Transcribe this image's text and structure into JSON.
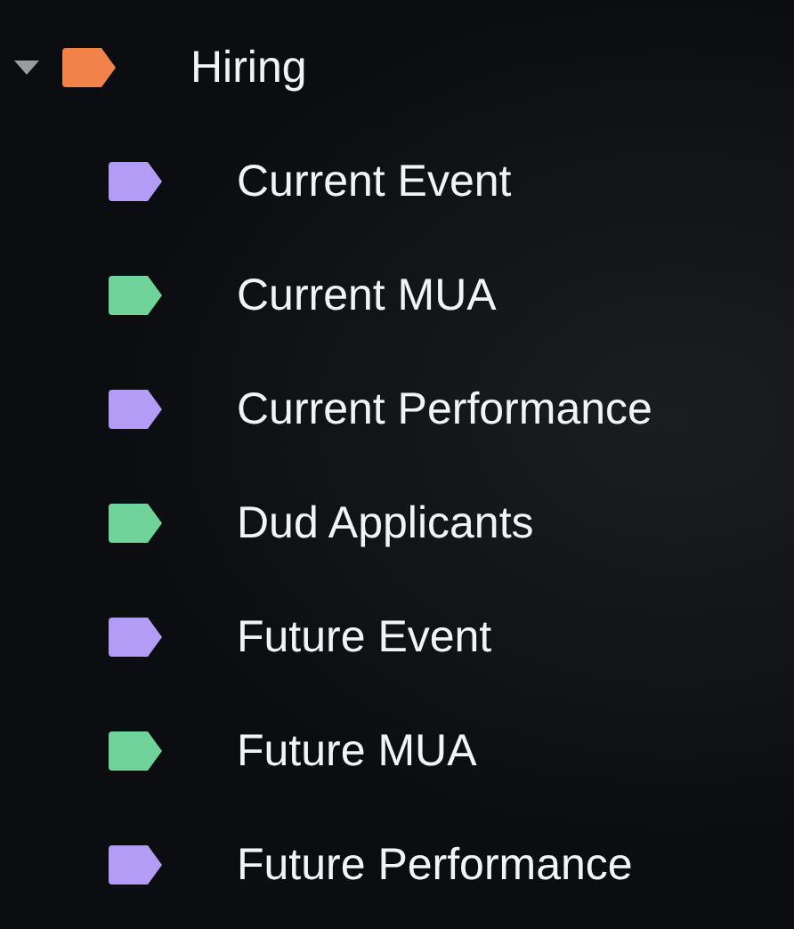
{
  "labels": [
    {
      "name": "Hiring",
      "color": "#f0824a",
      "expanded": true,
      "children": [
        {
          "name": "Current Event",
          "color": "#b39cf5"
        },
        {
          "name": "Current MUA",
          "color": "#6fd39a"
        },
        {
          "name": "Current Performance",
          "color": "#b39cf5"
        },
        {
          "name": "Dud Applicants",
          "color": "#6fd39a"
        },
        {
          "name": "Future Event",
          "color": "#b39cf5"
        },
        {
          "name": "Future MUA",
          "color": "#6fd39a"
        },
        {
          "name": "Future Performance",
          "color": "#b39cf5"
        }
      ]
    }
  ]
}
